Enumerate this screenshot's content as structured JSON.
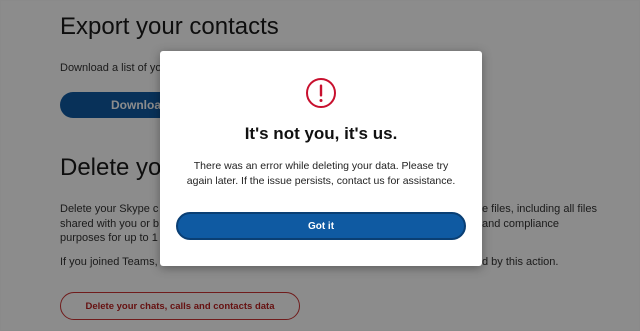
{
  "export_section": {
    "title": "Export your contacts",
    "description": "Download a list of yo",
    "download_button": "Downloa"
  },
  "delete_section": {
    "title": "Delete yo",
    "paragraph1_line1_left": "Delete your Skype c",
    "paragraph1_line1_right": "e files, including all files",
    "paragraph1_line2_left": "shared with you or b",
    "paragraph1_line2_right": "and compliance",
    "paragraph1_line3_left": "purposes for up to 1",
    "paragraph2_left": "If you joined Teams,",
    "paragraph2_right": "d by this action.",
    "delete_button": "Delete your chats, calls and contacts data"
  },
  "dialog": {
    "title": "It's not you, it's us.",
    "message": "There was an error while deleting your data. Please try again later. If the issue persists, contact us for assistance.",
    "button": "Got it",
    "icon": "error-icon",
    "icon_color": "#c8102e"
  }
}
